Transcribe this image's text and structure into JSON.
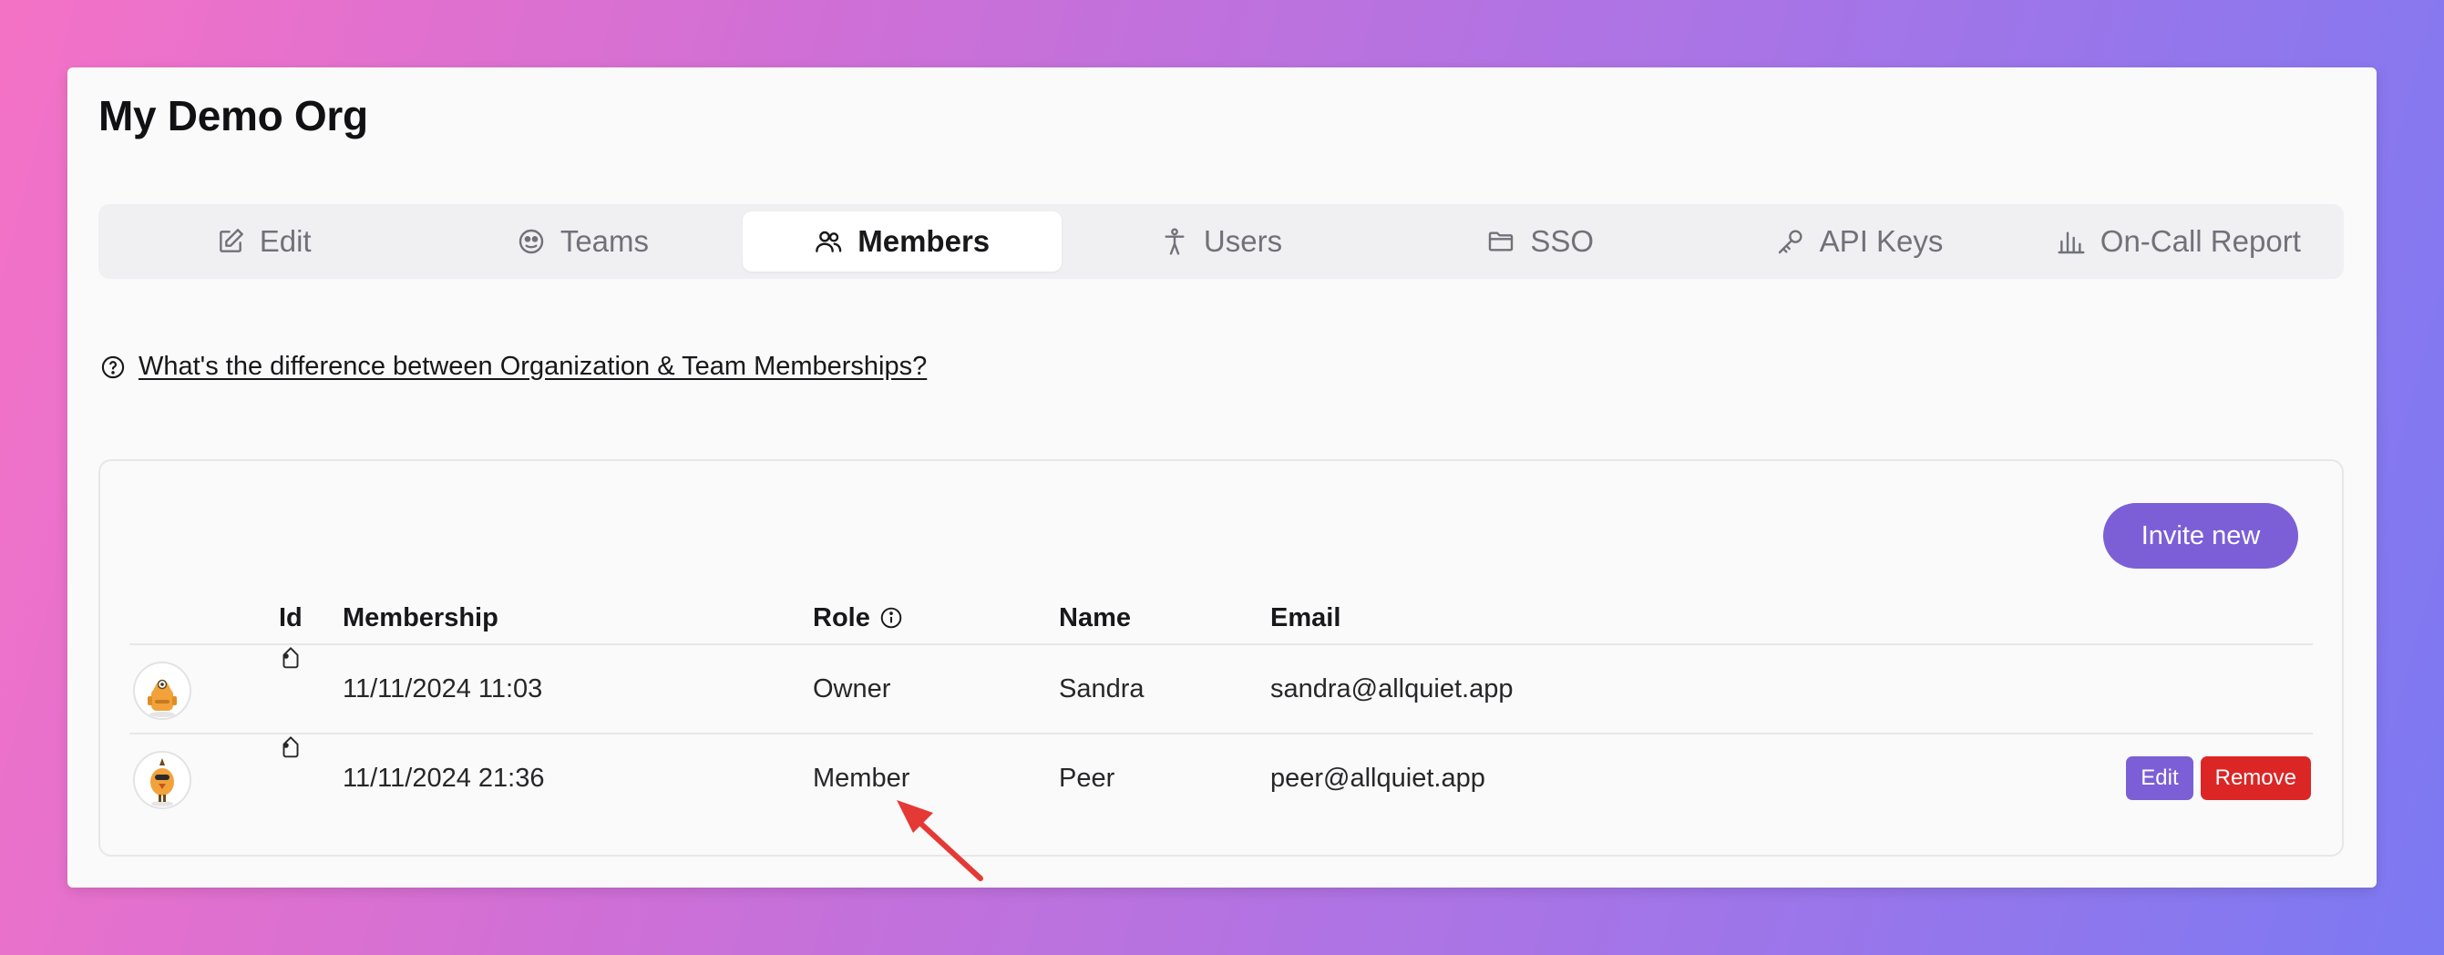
{
  "page": {
    "title": "My Demo Org"
  },
  "tabs": [
    {
      "label": "Edit",
      "icon": "edit-icon"
    },
    {
      "label": "Teams",
      "icon": "teams-icon"
    },
    {
      "label": "Members",
      "icon": "members-icon",
      "active": true
    },
    {
      "label": "Users",
      "icon": "users-icon"
    },
    {
      "label": "SSO",
      "icon": "folder-icon"
    },
    {
      "label": "API Keys",
      "icon": "key-icon"
    },
    {
      "label": "On-Call Report",
      "icon": "bar-chart-icon"
    }
  ],
  "help": {
    "link_text": "What's the difference between Organization & Team Memberships?",
    "icon": "question-circle-icon"
  },
  "members_panel": {
    "invite_label": "Invite new",
    "columns": {
      "id": "Id",
      "membership": "Membership",
      "role": "Role",
      "name": "Name",
      "email": "Email"
    },
    "rows": [
      {
        "membership": "11/11/2024 11:03",
        "role": "Owner",
        "name": "Sandra",
        "email": "sandra@allquiet.app",
        "avatar": "robot-avatar-icon"
      },
      {
        "membership": "11/11/2024 21:36",
        "role": "Member",
        "name": "Peer",
        "email": "peer@allquiet.app",
        "avatar": "bird-avatar-icon",
        "edit_label": "Edit",
        "remove_label": "Remove"
      }
    ]
  },
  "colors": {
    "accent": "#7c5fd6",
    "danger": "#dc2626",
    "annotation_arrow": "#e53935"
  }
}
